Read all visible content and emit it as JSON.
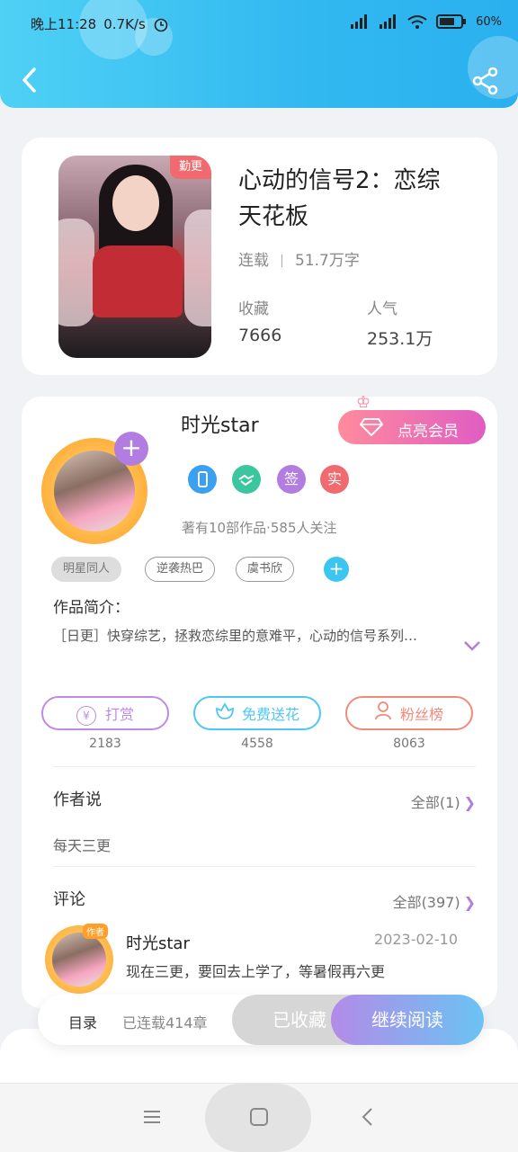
{
  "status_bar": {
    "time": "晚上11:28",
    "speed": "0.7K/s",
    "battery": "60%"
  },
  "book": {
    "badge": "勤更",
    "title": "心动的信号2：恋综天花板",
    "status": "连载",
    "word_count": "51.7万字",
    "favorites_label": "收藏",
    "favorites_value": "7666",
    "popularity_label": "人气",
    "popularity_value": "253.1万"
  },
  "author": {
    "name": "时光star",
    "vip_button": "点亮会员",
    "badges": [
      {
        "icon": "phone-icon",
        "text": ""
      },
      {
        "icon": "handshake-icon",
        "text": ""
      },
      {
        "icon": "sign-icon",
        "text": "签"
      },
      {
        "icon": "verified-icon",
        "text": "实"
      }
    ],
    "stats": "著有10部作品·585人关注",
    "tags": [
      "明星同人",
      "逆袭热巴",
      "虞书欣"
    ]
  },
  "intro": {
    "title": "作品简介：",
    "text": "［日更］快穿综艺，拯救恋综里的意难平，心动的信号系列…"
  },
  "actions": [
    {
      "label": "打赏",
      "count": "2183",
      "color": "#c08ae6",
      "icon": "yen-icon"
    },
    {
      "label": "免费送花",
      "count": "4558",
      "color": "#4cc8f2",
      "icon": "flower-icon"
    },
    {
      "label": "粉丝榜",
      "count": "8063",
      "color": "#f28a7a",
      "icon": "person-icon"
    }
  ],
  "author_say": {
    "title": "作者说",
    "link": "全部(1)",
    "text": "每天三更"
  },
  "comments": {
    "title": "评论",
    "link": "全部(397)",
    "items": [
      {
        "tag": "作者",
        "name": "时光star",
        "date": "2023-02-10",
        "text": "现在三更，要回去上学了，等暑假再六更"
      }
    ]
  },
  "bottom_bar": {
    "toc": "目录",
    "chapters": "已连载414章",
    "favorited": "已收藏",
    "continue": "继续阅读"
  }
}
